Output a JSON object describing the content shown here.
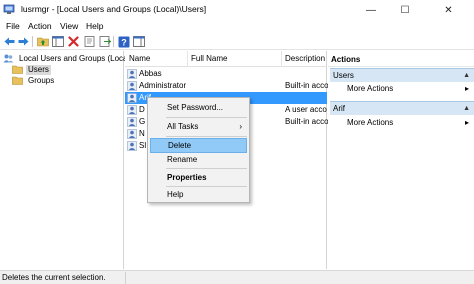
{
  "window": {
    "title": "lusrmgr - [Local Users and Groups (Local)\\Users]",
    "min_glyph": "—",
    "max_glyph": "☐",
    "close_glyph": "✕"
  },
  "menu": {
    "items": [
      "File",
      "Action",
      "View",
      "Help"
    ]
  },
  "toolbar": {
    "icons": [
      "back-arrow-icon",
      "forward-arrow-icon",
      "up-folder-icon",
      "show-hide-tree-icon",
      "delete-icon",
      "properties-icon",
      "export-list-icon",
      "help-icon",
      "show-hide-action-pane-icon"
    ]
  },
  "tree": {
    "root": "Local Users and Groups (Local)",
    "items": [
      "Users",
      "Groups"
    ]
  },
  "list": {
    "columns": [
      "Name",
      "Full Name",
      "Description"
    ],
    "rows": [
      {
        "name": "Abbas",
        "description": ""
      },
      {
        "name": "Administrator",
        "description": "Built-in acco"
      },
      {
        "name": "Arif",
        "description": ""
      },
      {
        "name": "D",
        "description": "A user acco"
      },
      {
        "name": "G",
        "description": "Built-in acco"
      },
      {
        "name": "N",
        "description": ""
      },
      {
        "name": "Sl",
        "description": ""
      }
    ]
  },
  "actions": {
    "title": "Actions",
    "sections": [
      {
        "label": "Users",
        "items": [
          "More Actions"
        ]
      },
      {
        "label": "Arif",
        "items": [
          "More Actions"
        ]
      }
    ]
  },
  "context_menu": {
    "items": [
      "Set Password...",
      "All Tasks",
      "Delete",
      "Rename",
      "Properties",
      "Help"
    ],
    "highlighted": "Delete"
  },
  "status": {
    "text": "Deletes the current selection."
  },
  "colors": {
    "selection": "#3399ff",
    "menu_highlight": "#91c9f7",
    "action_section": "#d6e6f5",
    "folder": "#e8c15c"
  }
}
